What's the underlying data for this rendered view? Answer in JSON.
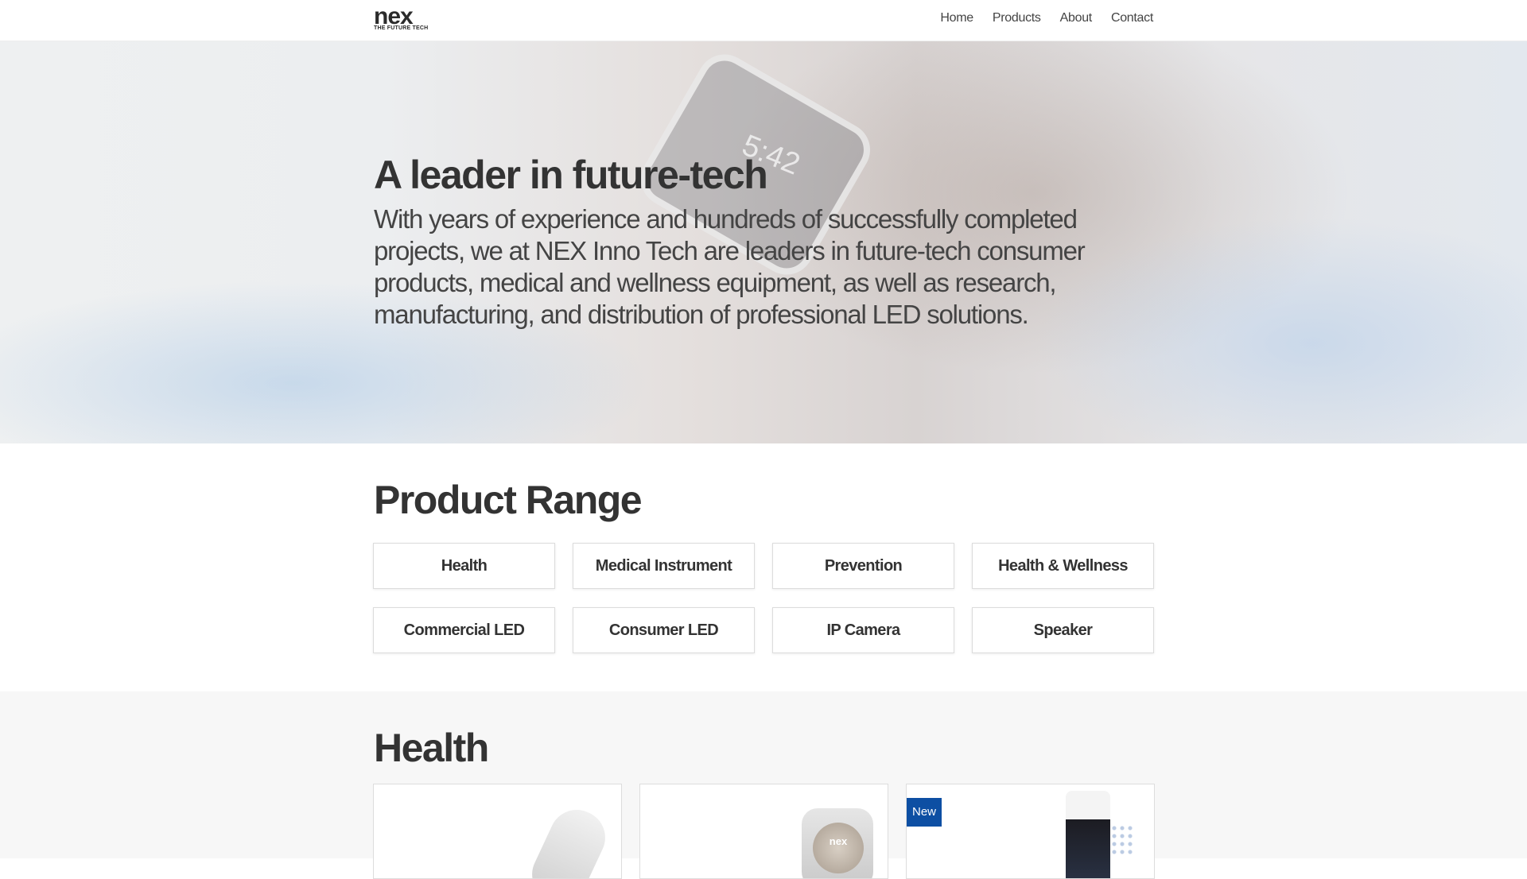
{
  "header": {
    "logo": {
      "word": "nex",
      "tagline": "THE FUTURE TECH"
    },
    "nav": [
      "Home",
      "Products",
      "About",
      "Contact"
    ]
  },
  "hero": {
    "watch_time": "5:42",
    "title": "A leader in future-tech",
    "text": "With years of experience and hundreds of successfully completed projects, we at NEX Inno Tech are leaders in future-tech consumer products, medical and wellness equipment, as well as research, manufacturing, and distribution of professional LED solutions."
  },
  "product_range": {
    "title": "Product Range",
    "categories": [
      "Health",
      "Medical Instrument",
      "Prevention",
      "Health & Wellness",
      "Commercial LED",
      "Consumer LED",
      "IP Camera",
      "Speaker"
    ]
  },
  "health": {
    "title": "Health",
    "cards": [
      {
        "badge": ""
      },
      {
        "badge": "",
        "product_label": "nex"
      },
      {
        "badge": "New"
      }
    ]
  },
  "colors": {
    "badge": "#0d4fa3",
    "text": "#333333",
    "section_bg": "#f7f7f7"
  }
}
